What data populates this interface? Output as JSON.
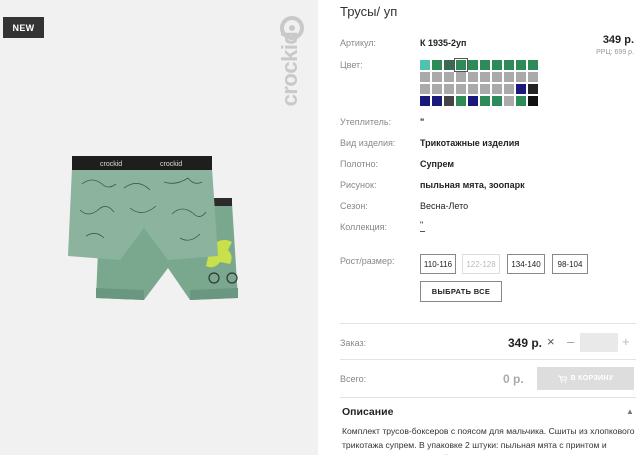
{
  "photo": {
    "badge": "NEW",
    "brand_text": "crockid",
    "waistband_text": "crockid"
  },
  "product": {
    "title": "Трусы/ уп",
    "price": "349 р.",
    "rrp": "РРЦ: 699 р.",
    "fields": [
      {
        "label": "Артикул:",
        "value": "К 1935-2уп"
      },
      {
        "label": "Цвет:",
        "value": ""
      },
      {
        "label": "Утеплитель:",
        "value": "\""
      },
      {
        "label": "Вид изделия:",
        "value": "Трикотажные изделия"
      },
      {
        "label": "Полотно:",
        "value": "Супрем"
      },
      {
        "label": "Рисунок:",
        "value": "пыльная мята, зоопарк"
      },
      {
        "label": "Сезон:",
        "value": "Весна-Лето"
      },
      {
        "label": "Коллекция:",
        "value": "\""
      },
      {
        "label": "Рост/размер:",
        "value": ""
      }
    ],
    "swatch_colors": [
      "#4fc3b0",
      "#2e8b57",
      "#3a6b52",
      "#2e8b57",
      "#2e8b57",
      "#2e8b57",
      "#2e8b57",
      "#2e8b57",
      "#2e8b57",
      "#2e8b57",
      "#aaaaaa",
      "#aaaaaa",
      "#aaaaaa",
      "#aaaaaa",
      "#aaaaaa",
      "#aaaaaa",
      "#aaaaaa",
      "#aaaaaa",
      "#aaaaaa",
      "#aaaaaa",
      "#aaaaaa",
      "#aaaaaa",
      "#aaaaaa",
      "#aaaaaa",
      "#aaaaaa",
      "#aaaaaa",
      "#aaaaaa",
      "#aaaaaa",
      "#1a1a7a",
      "#222222",
      "#1a1a7a",
      "#1a1a7a",
      "#444444",
      "#2e8b57",
      "#1a1a7a",
      "#2e8b57",
      "#2e8b57",
      "#aaaaaa",
      "#2e8b57",
      "#111111"
    ],
    "selected_swatch": 3,
    "sizes": [
      {
        "label": "110-116",
        "disabled": false
      },
      {
        "label": "122-128",
        "disabled": true
      },
      {
        "label": "134-140",
        "disabled": false
      },
      {
        "label": "98-104",
        "disabled": false
      }
    ],
    "select_all_label": "ВЫБРАТЬ ВСЕ"
  },
  "order": {
    "label": "Заказ:",
    "price": "349 р.",
    "times": "×",
    "minus": "–",
    "qty_value": "",
    "plus": "+"
  },
  "total": {
    "label": "Всего:",
    "value": "0 р.",
    "cart_label": "В КОРЗИНУ"
  },
  "description": {
    "title": "Описание",
    "text": "Комплект трусов-боксеров с поясом для мальчика. Сшиты из хлопкового трикотажа супрем. В упаковке 2 штуки: пыльная мята с принтом и пыльная мята однотонный. Резинка на поясе с логотипом."
  },
  "colors": {
    "accent_dark": "#333333",
    "shorts_green": "#7fab93"
  }
}
